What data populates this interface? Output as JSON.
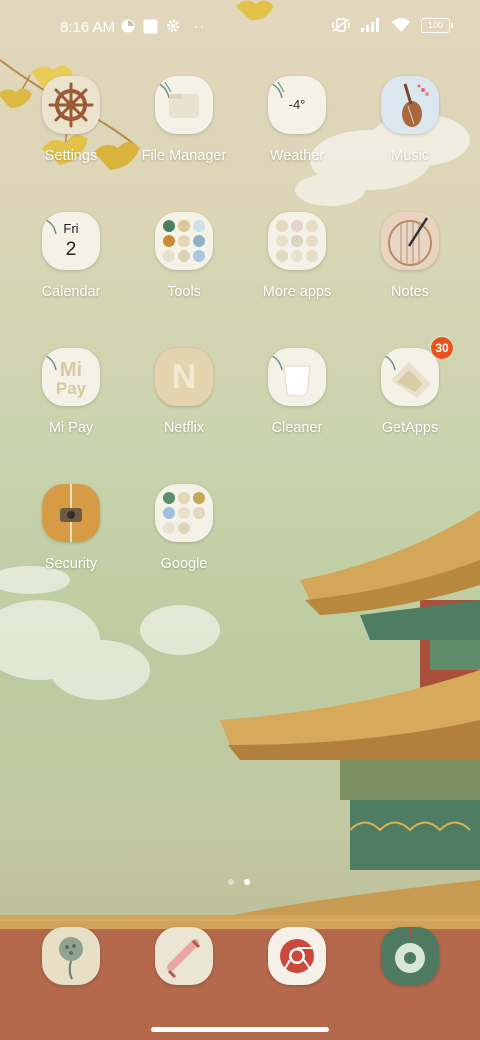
{
  "status_bar": {
    "time": "8:16 AM",
    "battery": "100",
    "icons": [
      "gallery-icon",
      "notification-square-icon",
      "settings-gear-icon",
      "more-dots-icon",
      "mute-vibrate-icon",
      "signal-icon",
      "wifi-icon",
      "battery-icon"
    ]
  },
  "apps": [
    {
      "id": "settings",
      "label": "Settings",
      "icon": "ship-wheel-icon"
    },
    {
      "id": "file-manager",
      "label": "File Manager",
      "icon": "folder-icon"
    },
    {
      "id": "weather",
      "label": "Weather",
      "icon": "weather-icon",
      "temp": "-4°"
    },
    {
      "id": "music",
      "label": "Music",
      "icon": "pipa-lute-icon"
    },
    {
      "id": "calendar",
      "label": "Calendar",
      "icon": "calendar-icon",
      "day": "Fri",
      "date": "2"
    },
    {
      "id": "tools",
      "label": "Tools",
      "icon": "folder-grid-icon"
    },
    {
      "id": "more-apps",
      "label": "More apps",
      "icon": "folder-grid-icon"
    },
    {
      "id": "notes",
      "label": "Notes",
      "icon": "brush-scroll-icon"
    },
    {
      "id": "mi-pay",
      "label": "Mi Pay",
      "icon": "mi-pay-icon",
      "logo_top": "Mi",
      "logo_bottom": "Pay"
    },
    {
      "id": "netflix",
      "label": "Netflix",
      "icon": "netflix-icon",
      "logo": "N"
    },
    {
      "id": "cleaner",
      "label": "Cleaner",
      "icon": "trash-bin-icon"
    },
    {
      "id": "getapps",
      "label": "GetApps",
      "icon": "getapps-icon",
      "badge": "30"
    },
    {
      "id": "security",
      "label": "Security",
      "icon": "shield-lock-icon"
    },
    {
      "id": "google",
      "label": "Google",
      "icon": "folder-grid-icon"
    }
  ],
  "dock": [
    {
      "id": "phone",
      "icon": "lotus-pod-icon"
    },
    {
      "id": "messages",
      "icon": "scroll-message-icon"
    },
    {
      "id": "chrome",
      "icon": "chrome-browser-icon"
    },
    {
      "id": "camera",
      "icon": "jade-camera-icon"
    }
  ],
  "pages": {
    "count": 2,
    "active": 1
  },
  "colors": {
    "badge": "#e8531f",
    "icon_cream": "#f4f1e6",
    "dock_green": "#4e7a62",
    "roof_gold": "#c99c4c",
    "wall_red": "#b4684c"
  }
}
